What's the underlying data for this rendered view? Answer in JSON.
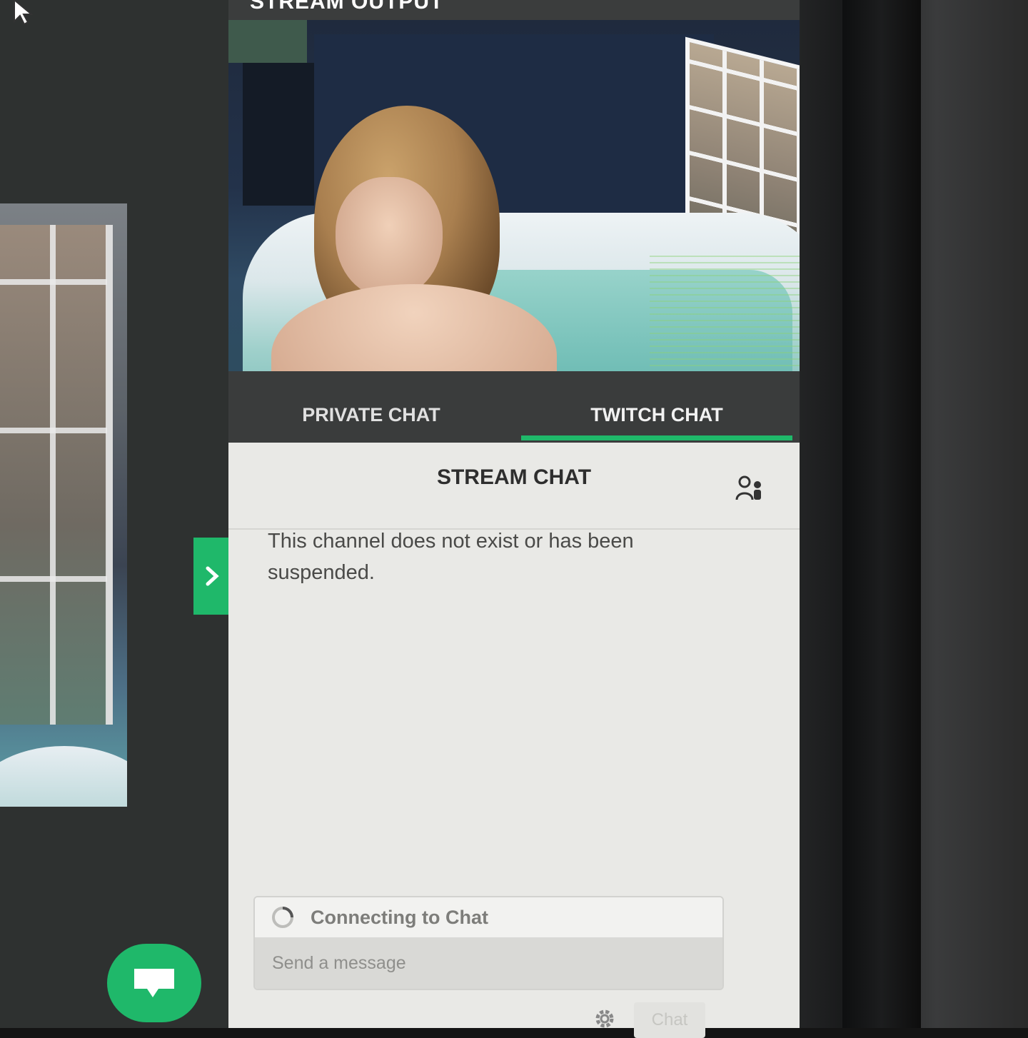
{
  "stream_output": {
    "title": "STREAM OUTPUT"
  },
  "chat_tabs": [
    {
      "label": "PRIVATE CHAT"
    },
    {
      "label": "TWITCH CHAT"
    }
  ],
  "chat": {
    "title": "STREAM CHAT",
    "message": "This channel does not exist or has been suspended.",
    "status": "Connecting to Chat",
    "input_placeholder": "Send a message",
    "send_label": "Chat"
  },
  "colors": {
    "accent": "#1fb86a",
    "panel_bg": "#e9e9e6",
    "header_bg": "#3b3d3d"
  },
  "icons": {
    "cursor": "mouse-pointer-icon",
    "dropdown": "caret-down-icon",
    "viewers": "users-icon",
    "expand": "chevron-right-icon",
    "fab": "chat-bubble-icon",
    "spinner": "loading-spinner-icon",
    "settings": "gear-icon"
  }
}
